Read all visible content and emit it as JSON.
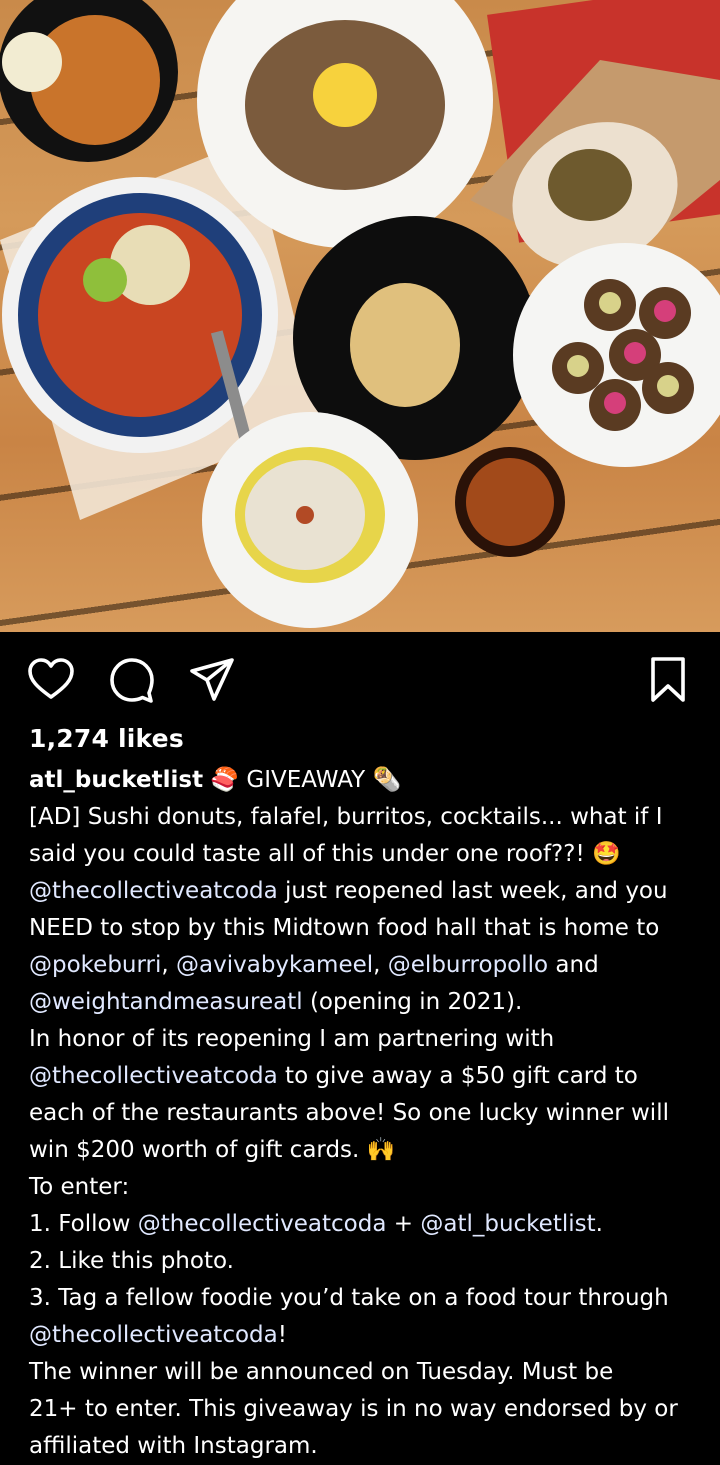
{
  "post": {
    "image_description_icon": "food-photo",
    "likes": "1,274 likes",
    "username": "atl_bucketlist",
    "caption_lines": [
      [
        {
          "t": "user",
          "v": "atl_bucketlist"
        },
        {
          "t": "text",
          "v": " 🍣 GIVEAWAY 🌯"
        }
      ],
      [
        {
          "t": "text",
          "v": "[AD] Sushi donuts, falafel, burritos, cocktails... what if I"
        }
      ],
      [
        {
          "t": "text",
          "v": "said you could taste all of this under one roof??! 🤩"
        }
      ],
      [
        {
          "t": "mention",
          "v": "@thecollectiveatcoda"
        },
        {
          "t": "text",
          "v": " just reopened last week, and you"
        }
      ],
      [
        {
          "t": "text",
          "v": "NEED to stop by this Midtown food hall that is home to"
        }
      ],
      [
        {
          "t": "mention",
          "v": "@pokeburri"
        },
        {
          "t": "text",
          "v": ", "
        },
        {
          "t": "mention",
          "v": "@avivabykameel"
        },
        {
          "t": "text",
          "v": ", "
        },
        {
          "t": "mention",
          "v": "@elburropollo"
        },
        {
          "t": "text",
          "v": " and"
        }
      ],
      [
        {
          "t": "mention",
          "v": "@weightandmeasureatl"
        },
        {
          "t": "text",
          "v": " (opening in 2021)."
        }
      ],
      [
        {
          "t": "text",
          "v": "In honor of its reopening I am partnering with"
        }
      ],
      [
        {
          "t": "mention",
          "v": "@thecollectiveatcoda"
        },
        {
          "t": "text",
          "v": " to give away a $50 gift card to"
        }
      ],
      [
        {
          "t": "text",
          "v": "each of the restaurants above! So one lucky winner will"
        }
      ],
      [
        {
          "t": "text",
          "v": "win $200 worth of gift cards. 🙌"
        }
      ],
      [
        {
          "t": "text",
          "v": "To enter:"
        }
      ],
      [
        {
          "t": "text",
          "v": "1. Follow "
        },
        {
          "t": "mention",
          "v": "@thecollectiveatcoda"
        },
        {
          "t": "text",
          "v": " + "
        },
        {
          "t": "mention",
          "v": "@atl_bucketlist"
        },
        {
          "t": "text",
          "v": "."
        }
      ],
      [
        {
          "t": "text",
          "v": "2. Like this photo."
        }
      ],
      [
        {
          "t": "text",
          "v": "3. Tag a fellow foodie you’d take on a food tour through"
        }
      ],
      [
        {
          "t": "mention",
          "v": "@thecollectiveatcoda"
        },
        {
          "t": "text",
          "v": "!"
        }
      ],
      [
        {
          "t": "text",
          "v": "The winner will be announced on Tuesday. Must be"
        }
      ],
      [
        {
          "t": "text",
          "v": "21+ to enter. This giveaway is in no way endorsed by or"
        }
      ],
      [
        {
          "t": "text",
          "v": "affiliated with Instagram."
        }
      ]
    ]
  },
  "actions": {
    "like_icon": "heart-icon",
    "comment_icon": "comment-icon",
    "share_icon": "send-icon",
    "save_icon": "bookmark-icon"
  }
}
